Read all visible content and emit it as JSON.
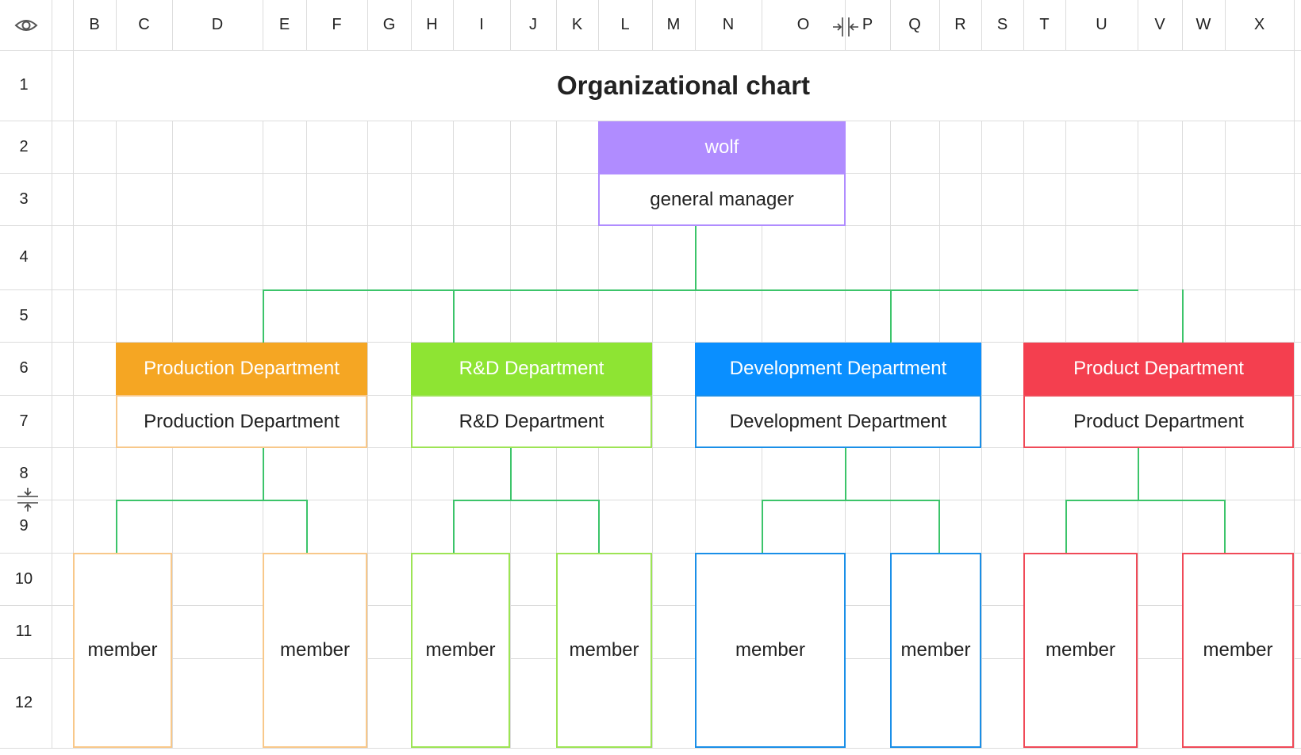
{
  "columns": [
    "B",
    "C",
    "D",
    "E",
    "F",
    "G",
    "H",
    "I",
    "J",
    "K",
    "L",
    "M",
    "N",
    "O",
    "P",
    "Q",
    "R",
    "S",
    "T",
    "U",
    "V",
    "W",
    "X"
  ],
  "rows": [
    "1",
    "2",
    "3",
    "4",
    "5",
    "6",
    "7",
    "8",
    "9",
    "10",
    "11",
    "12"
  ],
  "title": "Organizational chart",
  "root": {
    "name": "wolf",
    "role": "general manager",
    "color": "#b08cff",
    "border": "#b08cff"
  },
  "departments": [
    {
      "header": "Production Department",
      "label": "Production Department",
      "color": "#f5a623",
      "border": "#f8c88a",
      "members": [
        "member",
        "member"
      ]
    },
    {
      "header": "R&D Department",
      "label": "R&D Department",
      "color": "#8ee433",
      "border": "#9de455",
      "members": [
        "member",
        "member"
      ]
    },
    {
      "header": "Development Department",
      "label": "Development Department",
      "color": "#0a8fff",
      "border": "#1a8fe8",
      "members": [
        "member",
        "member"
      ]
    },
    {
      "header": "Product Department",
      "label": "Product Department",
      "color": "#f43f4f",
      "border": "#f04a58",
      "members": [
        "member",
        "member"
      ]
    }
  ],
  "colors": {
    "connector": "#3cc46a",
    "grid": "#dcdcdc"
  },
  "icons": {
    "corner": "eye-icon",
    "column_resize": "column-resize-icon",
    "row_resize": "row-resize-icon"
  }
}
